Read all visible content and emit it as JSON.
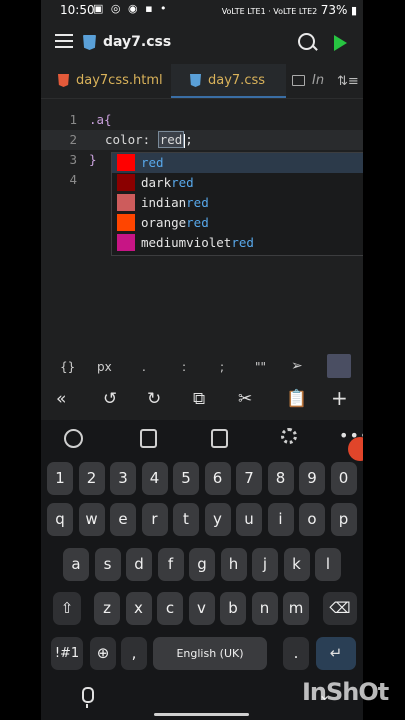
{
  "status_bar": {
    "time": "10:50",
    "battery": "73%",
    "network": "VoLTE LTE1 · VoLTE LTE2"
  },
  "toolbar": {
    "file_title": "day7.css"
  },
  "tabs": [
    {
      "label": "day7css.html",
      "type": "html"
    },
    {
      "label": "day7.css",
      "type": "css",
      "active": true
    },
    {
      "label": "In",
      "type": "preview"
    }
  ],
  "editor": {
    "lines": [
      {
        "num": "1",
        "selector": ".a{"
      },
      {
        "num": "2",
        "property": "color: ",
        "value": "red",
        "suffix": ";"
      },
      {
        "num": "3",
        "selector": "}"
      },
      {
        "num": "4",
        "selector": ""
      }
    ]
  },
  "autocomplete": {
    "items": [
      {
        "prefix": "",
        "match": "red",
        "color": "#ff0000"
      },
      {
        "prefix": "dark",
        "match": "red",
        "color": "#8b0000"
      },
      {
        "prefix": "indian",
        "match": "red",
        "color": "#cd5c5c"
      },
      {
        "prefix": "orange",
        "match": "red",
        "color": "#ff4500"
      },
      {
        "prefix": "mediumviolet",
        "match": "red",
        "color": "#c71585"
      }
    ]
  },
  "symbol_bar": {
    "items": [
      "{}",
      "px",
      ".",
      ":",
      ";",
      "\"\""
    ]
  },
  "keyboard": {
    "row_numbers": [
      "1",
      "2",
      "3",
      "4",
      "5",
      "6",
      "7",
      "8",
      "9",
      "0"
    ],
    "row1": [
      "q",
      "w",
      "e",
      "r",
      "t",
      "y",
      "u",
      "i",
      "o",
      "p"
    ],
    "row2": [
      "a",
      "s",
      "d",
      "f",
      "g",
      "h",
      "j",
      "k",
      "l"
    ],
    "row3": [
      "z",
      "x",
      "c",
      "v",
      "b",
      "n",
      "m"
    ],
    "symbols_key": "!#1",
    "comma_key": ",",
    "space_label": "English (UK)",
    "period_key": "."
  },
  "watermark": "InShOt"
}
